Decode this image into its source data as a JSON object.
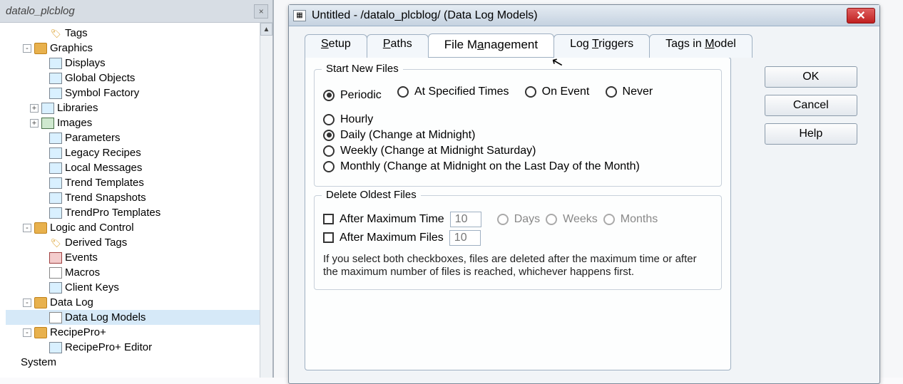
{
  "left": {
    "title": "datalo_plcblog",
    "nodes": [
      {
        "label": "Tags",
        "icon": "ic-tag",
        "indent": "pad2",
        "exp": ""
      },
      {
        "label": "Graphics",
        "icon": "ic-folder",
        "indent": "pad1",
        "exp": "-"
      },
      {
        "label": "Displays",
        "icon": "ic-generic",
        "indent": "pad2",
        "exp": ""
      },
      {
        "label": "Global Objects",
        "icon": "ic-generic",
        "indent": "pad2",
        "exp": ""
      },
      {
        "label": "Symbol Factory",
        "icon": "ic-generic",
        "indent": "pad2",
        "exp": ""
      },
      {
        "label": "Libraries",
        "icon": "ic-generic",
        "indent": "pad2b",
        "exp": "+"
      },
      {
        "label": "Images",
        "icon": "ic-img",
        "indent": "pad2b",
        "exp": "+"
      },
      {
        "label": "Parameters",
        "icon": "ic-generic",
        "indent": "pad2",
        "exp": ""
      },
      {
        "label": "Legacy Recipes",
        "icon": "ic-generic",
        "indent": "pad2",
        "exp": ""
      },
      {
        "label": "Local Messages",
        "icon": "ic-generic",
        "indent": "pad2",
        "exp": ""
      },
      {
        "label": "Trend Templates",
        "icon": "ic-generic",
        "indent": "pad2",
        "exp": ""
      },
      {
        "label": "Trend Snapshots",
        "icon": "ic-generic",
        "indent": "pad2",
        "exp": ""
      },
      {
        "label": "TrendPro Templates",
        "icon": "ic-generic",
        "indent": "pad2",
        "exp": ""
      },
      {
        "label": "Logic and Control",
        "icon": "ic-folder",
        "indent": "pad1",
        "exp": "-"
      },
      {
        "label": "Derived Tags",
        "icon": "ic-tag",
        "indent": "pad2",
        "exp": ""
      },
      {
        "label": "Events",
        "icon": "ic-red",
        "indent": "pad2",
        "exp": ""
      },
      {
        "label": "Macros",
        "icon": "ic-page",
        "indent": "pad2",
        "exp": ""
      },
      {
        "label": "Client Keys",
        "icon": "ic-generic",
        "indent": "pad2",
        "exp": ""
      },
      {
        "label": "Data Log",
        "icon": "ic-folder",
        "indent": "pad1",
        "exp": "-"
      },
      {
        "label": "Data Log Models",
        "icon": "ic-page",
        "indent": "pad2",
        "exp": "",
        "sel": true
      },
      {
        "label": "RecipePro+",
        "icon": "ic-folder",
        "indent": "pad1",
        "exp": "-"
      },
      {
        "label": "RecipePro+ Editor",
        "icon": "ic-generic",
        "indent": "pad2",
        "exp": ""
      },
      {
        "label": "System",
        "icon": "",
        "indent": "pad0",
        "exp": ""
      }
    ]
  },
  "dialog": {
    "title": "Untitled - /datalo_plcblog/ (Data Log Models)",
    "tabs": {
      "setup": {
        "pre": "",
        "u": "S",
        "post": "etup"
      },
      "paths": {
        "pre": "",
        "u": "P",
        "post": "aths"
      },
      "filemgmt": {
        "pre": "File M",
        "u": "a",
        "post": "nagement"
      },
      "logtrig": {
        "pre": "Log ",
        "u": "T",
        "post": "riggers"
      },
      "tagsmodel": {
        "pre": "Tags in ",
        "u": "M",
        "post": "odel"
      }
    },
    "start_new": {
      "legend": "Start New Files",
      "opt_periodic": "Periodic",
      "opt_specified": "At Specified Times",
      "opt_onevent": "On Event",
      "opt_never": "Never",
      "freq_hourly": "Hourly",
      "freq_daily": "Daily (Change at Midnight)",
      "freq_weekly": "Weekly (Change at Midnight Saturday)",
      "freq_monthly": "Monthly (Change at Midnight on the Last Day of the Month)"
    },
    "delete_oldest": {
      "legend": "Delete Oldest Files",
      "after_time": "After Maximum Time",
      "after_files": "After Maximum Files",
      "time_value": "10",
      "files_value": "10",
      "unit_days": "Days",
      "unit_weeks": "Weeks",
      "unit_months": "Months",
      "help": "If you select both checkboxes, files are deleted after the maximum time or after the maximum number of files is reached, whichever happens first."
    },
    "buttons": {
      "ok": "OK",
      "cancel": "Cancel",
      "help": "Help"
    },
    "close_glyph": "✕"
  }
}
